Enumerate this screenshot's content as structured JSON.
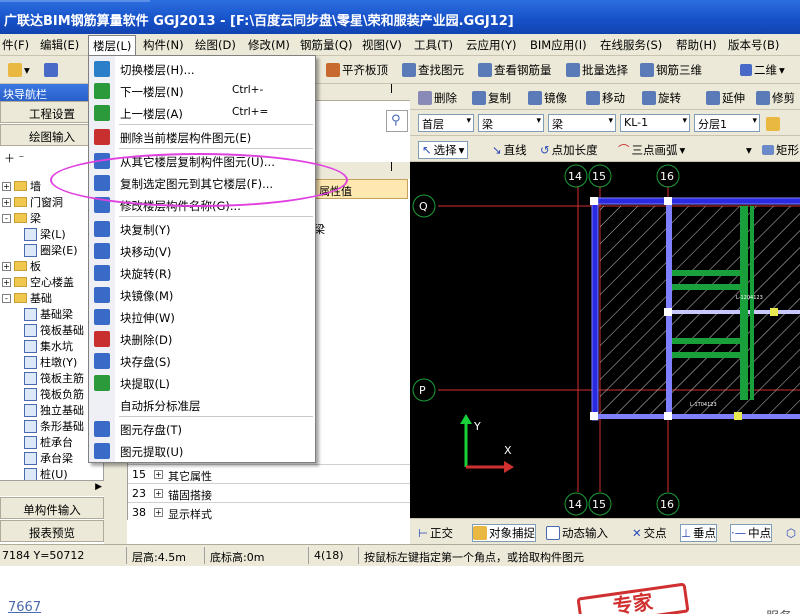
{
  "title": "广联达BIM钢筋算量软件 GGJ2013 - [F:\\百度云同步盘\\零星\\荣和服装产业园.GGJ12]",
  "menubar": [
    "件(F)",
    "编辑(E)",
    "楼层(L)",
    "构件(N)",
    "绘图(D)",
    "修改(M)",
    "钢筋量(Q)",
    "视图(V)",
    "工具(T)",
    "云应用(Y)",
    "BIM应用(I)",
    "在线服务(S)",
    "帮助(H)",
    "版本号(B)"
  ],
  "toolbar1": {
    "flat_roof": "平齐板顶",
    "find": "查找图元",
    "view_rebar": "查看钢筋量",
    "batch_select": "批量选择",
    "rebar_3d": "钢筋三维",
    "view_mode": "二维"
  },
  "nav": {
    "title": "块导航栏",
    "pin": "ꟾ",
    "project_settings": "工程设置",
    "drawing_input": "绘图输入",
    "tree": [
      {
        "label": "墙",
        "type": "folder",
        "expander": "+"
      },
      {
        "label": "门窗洞",
        "type": "folder",
        "expander": "+"
      },
      {
        "label": "梁",
        "type": "folder",
        "expander": "-"
      },
      {
        "label": "梁(L)",
        "type": "leaf"
      },
      {
        "label": "圈梁(E)",
        "type": "leaf"
      },
      {
        "label": "板",
        "type": "folder",
        "expander": "+"
      },
      {
        "label": "空心楼盖",
        "type": "folder",
        "expander": "+"
      },
      {
        "label": "基础",
        "type": "folder",
        "expander": "-"
      },
      {
        "label": "基础梁",
        "type": "leaf"
      },
      {
        "label": "筏板基础",
        "type": "leaf"
      },
      {
        "label": "集水坑",
        "type": "leaf"
      },
      {
        "label": "柱墩(Y)",
        "type": "leaf"
      },
      {
        "label": "筏板主筋",
        "type": "leaf"
      },
      {
        "label": "筏板负筋",
        "type": "leaf"
      },
      {
        "label": "独立基础",
        "type": "leaf"
      },
      {
        "label": "条形基础",
        "type": "leaf"
      },
      {
        "label": "桩承台",
        "type": "leaf"
      },
      {
        "label": "承台梁",
        "type": "leaf"
      },
      {
        "label": "桩(U)",
        "type": "leaf"
      }
    ],
    "single_input": "单构件输入",
    "report_preview": "报表预览"
  },
  "mid": {
    "pin": "ꟾ",
    "attr_header": "属性值",
    "attr_value": "梁",
    "rows": [
      {
        "num": "15",
        "label": "其它属性"
      },
      {
        "num": "23",
        "label": "锚固搭接"
      },
      {
        "num": "38",
        "label": "显示样式"
      }
    ]
  },
  "toolbar2": {
    "delete": "删除",
    "copy": "复制",
    "mirror": "镜像",
    "move": "移动",
    "rotate": "旋转",
    "extend": "延伸",
    "trim": "修剪"
  },
  "toolbar3": {
    "floor": "首层",
    "cat": "梁",
    "type": "梁",
    "name": "KL-1",
    "layer": "分层1"
  },
  "toolbar4": {
    "select": "选择",
    "line": "直线",
    "point_length": "点加长度",
    "arc": "三点画弧",
    "rect": "矩形"
  },
  "canvas": {
    "axes_top": [
      "14",
      "15",
      "16"
    ],
    "axes_bottom": [
      "14",
      "15",
      "16"
    ],
    "axes_left": [
      "Q",
      "P"
    ],
    "axis_y_label": "Y",
    "axis_x_label": "X",
    "tiny1": "L-1204123",
    "tiny2": "L-1T04123"
  },
  "toolbar5": {
    "ortho": "正交",
    "snap": "对象捕捉",
    "dynamic": "动态输入",
    "intersection": "交点",
    "perpendicular": "垂点",
    "midpoint": "中点"
  },
  "status": {
    "coords": "7184 Y=50712",
    "floor_height": "层高:4.5m",
    "base_elev": "底标高:0m",
    "count": "4(18)",
    "hint": "按鼠标左键指定第一个角点，或拾取构件图元"
  },
  "below": {
    "link": "7667",
    "stamp": "专家",
    "right": "服务"
  },
  "dropdown": [
    {
      "label": "切换楼层(H)...",
      "shortcut": "",
      "sep_after": false,
      "icon": "switch-floor-icon",
      "color": "#2a7fc8"
    },
    {
      "label": "下一楼层(N)",
      "shortcut": "Ctrl+-",
      "sep_after": false,
      "icon": "next-floor-icon",
      "color": "#2a9a3a"
    },
    {
      "label": "上一楼层(A)",
      "shortcut": "Ctrl+=",
      "sep_after": true,
      "icon": "prev-floor-icon",
      "color": "#2a9a3a"
    },
    {
      "label": "删除当前楼层构件图元(E)",
      "shortcut": "",
      "sep_after": true,
      "icon": "delete-floor-icon",
      "color": "#c83030"
    },
    {
      "label": "从其它楼层复制构件图元(U)...",
      "shortcut": "",
      "sep_after": false,
      "icon": "copy-from-floor-icon",
      "color": "#3a6ac8"
    },
    {
      "label": "复制选定图元到其它楼层(F)...",
      "shortcut": "",
      "sep_after": false,
      "icon": "copy-to-floor-icon",
      "color": "#3a6ac8"
    },
    {
      "label": "修改楼层构件名称(G)...",
      "shortcut": "",
      "sep_after": true,
      "icon": "rename-icon",
      "color": "#3a6ac8"
    },
    {
      "label": "块复制(Y)",
      "shortcut": "",
      "sep_after": false,
      "icon": "block-copy-icon",
      "color": "#3a6ac8"
    },
    {
      "label": "块移动(V)",
      "shortcut": "",
      "sep_after": false,
      "icon": "block-move-icon",
      "color": "#3a6ac8"
    },
    {
      "label": "块旋转(R)",
      "shortcut": "",
      "sep_after": false,
      "icon": "block-rotate-icon",
      "color": "#3a6ac8"
    },
    {
      "label": "块镜像(M)",
      "shortcut": "",
      "sep_after": false,
      "icon": "block-mirror-icon",
      "color": "#3a6ac8"
    },
    {
      "label": "块拉伸(W)",
      "shortcut": "",
      "sep_after": false,
      "icon": "block-stretch-icon",
      "color": "#3a6ac8"
    },
    {
      "label": "块删除(D)",
      "shortcut": "",
      "sep_after": false,
      "icon": "block-delete-icon",
      "color": "#c83030"
    },
    {
      "label": "块存盘(S)",
      "shortcut": "",
      "sep_after": false,
      "icon": "block-save-icon",
      "color": "#3a6ac8"
    },
    {
      "label": "块提取(L)",
      "shortcut": "",
      "sep_after": false,
      "icon": "block-extract-icon",
      "color": "#2a9a3a"
    },
    {
      "label": "自动拆分标准层",
      "shortcut": "",
      "sep_after": true,
      "icon": "",
      "color": ""
    },
    {
      "label": "图元存盘(T)",
      "shortcut": "",
      "sep_after": false,
      "icon": "element-save-icon",
      "color": "#3a6ac8"
    },
    {
      "label": "图元提取(U)",
      "shortcut": "",
      "sep_after": false,
      "icon": "element-extract-icon",
      "color": "#3a6ac8"
    }
  ]
}
